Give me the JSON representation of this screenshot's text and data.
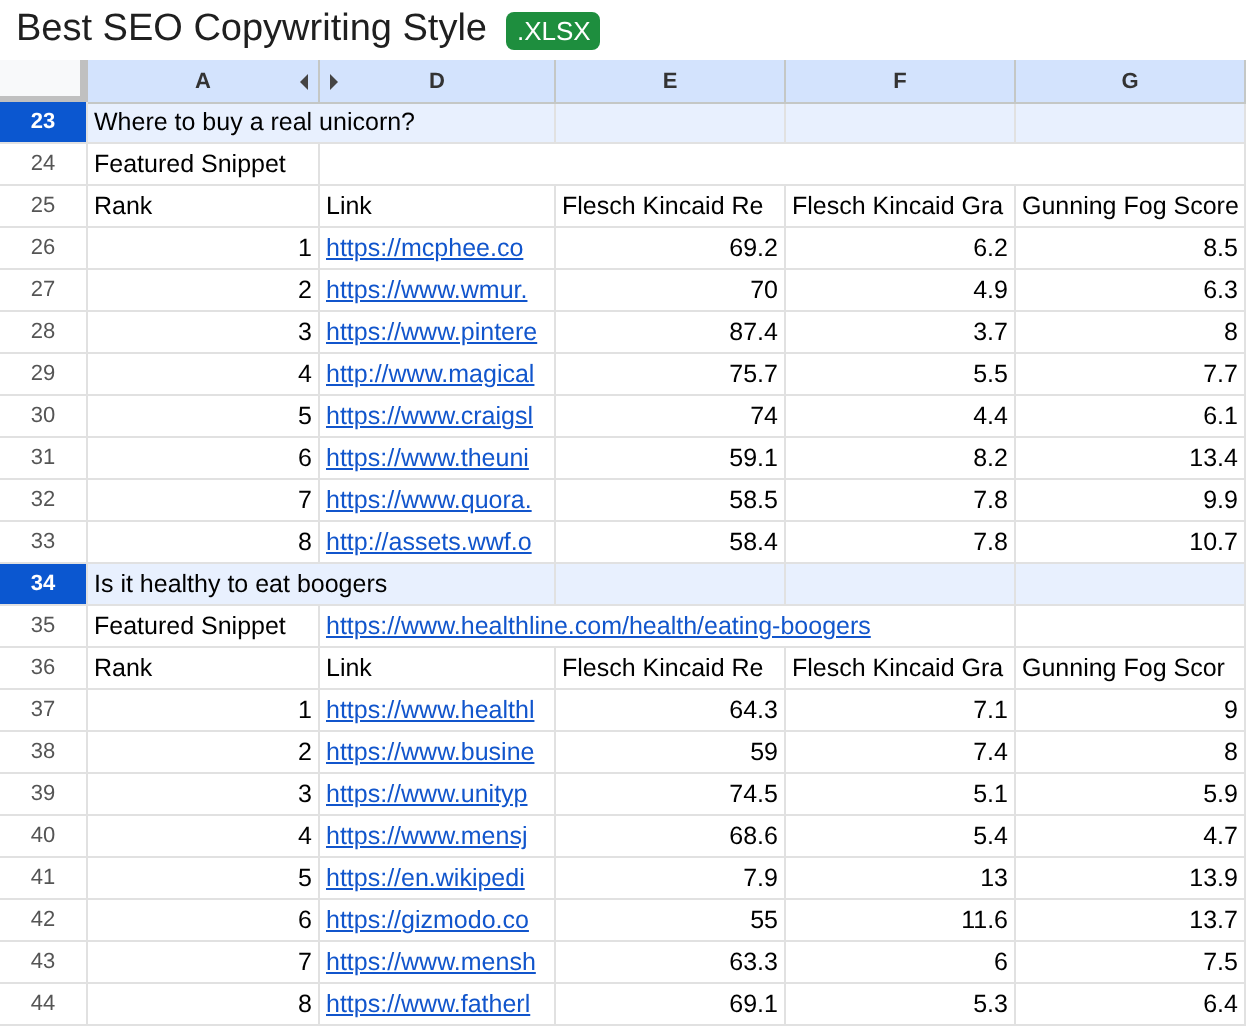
{
  "document": {
    "title": "Best SEO Copywriting Style",
    "badge": ".XLSX"
  },
  "columns": [
    {
      "label": "A",
      "hidden_after": true
    },
    {
      "label": "D",
      "hidden_after": false
    },
    {
      "label": "E",
      "hidden_after": false
    },
    {
      "label": "F",
      "hidden_after": false
    },
    {
      "label": "G",
      "hidden_after": false
    }
  ],
  "rows": [
    {
      "number": "23",
      "kind": "section",
      "selected": true,
      "text": "Where to buy a real unicorn?"
    },
    {
      "number": "24",
      "kind": "snippet",
      "selected": false,
      "label": "Featured Snippet"
    },
    {
      "number": "25",
      "kind": "header",
      "selected": false,
      "cells": [
        "Rank",
        "Link",
        "Flesch Kincaid Re",
        "Flesch Kincaid Gra",
        "Gunning Fog Score"
      ]
    },
    {
      "number": "26",
      "kind": "data",
      "selected": false,
      "rank": "1",
      "link": "https://mcphee.co",
      "values": [
        "69.2",
        "6.2",
        "8.5"
      ]
    },
    {
      "number": "27",
      "kind": "data",
      "selected": false,
      "rank": "2",
      "link": "https://www.wmur.",
      "values": [
        "70",
        "4.9",
        "6.3"
      ]
    },
    {
      "number": "28",
      "kind": "data",
      "selected": false,
      "rank": "3",
      "link": "https://www.pintere",
      "values": [
        "87.4",
        "3.7",
        "8"
      ]
    },
    {
      "number": "29",
      "kind": "data",
      "selected": false,
      "rank": "4",
      "link": "http://www.magical",
      "values": [
        "75.7",
        "5.5",
        "7.7"
      ]
    },
    {
      "number": "30",
      "kind": "data",
      "selected": false,
      "rank": "5",
      "link": "https://www.craigsl",
      "values": [
        "74",
        "4.4",
        "6.1"
      ]
    },
    {
      "number": "31",
      "kind": "data",
      "selected": false,
      "rank": "6",
      "link": "https://www.theuni",
      "values": [
        "59.1",
        "8.2",
        "13.4"
      ]
    },
    {
      "number": "32",
      "kind": "data",
      "selected": false,
      "rank": "7",
      "link": "https://www.quora.",
      "values": [
        "58.5",
        "7.8",
        "9.9"
      ]
    },
    {
      "number": "33",
      "kind": "data",
      "selected": false,
      "rank": "8",
      "link": "http://assets.wwf.o",
      "values": [
        "58.4",
        "7.8",
        "10.7"
      ]
    },
    {
      "number": "34",
      "kind": "section",
      "selected": true,
      "text": "Is it healthy to eat boogers"
    },
    {
      "number": "35",
      "kind": "snippet",
      "selected": false,
      "label": "Featured Snippet",
      "link": "https://www.healthline.com/health/eating-boogers"
    },
    {
      "number": "36",
      "kind": "header",
      "selected": false,
      "cells": [
        "Rank",
        "Link",
        "Flesch Kincaid Re",
        "Flesch Kincaid Gra",
        "Gunning Fog Scor"
      ]
    },
    {
      "number": "37",
      "kind": "data",
      "selected": false,
      "rank": "1",
      "link": "https://www.healthl",
      "values": [
        "64.3",
        "7.1",
        "9"
      ]
    },
    {
      "number": "38",
      "kind": "data",
      "selected": false,
      "rank": "2",
      "link": "https://www.busine",
      "values": [
        "59",
        "7.4",
        "8"
      ]
    },
    {
      "number": "39",
      "kind": "data",
      "selected": false,
      "rank": "3",
      "link": "https://www.unityp",
      "values": [
        "74.5",
        "5.1",
        "5.9"
      ]
    },
    {
      "number": "40",
      "kind": "data",
      "selected": false,
      "rank": "4",
      "link": "https://www.mensj",
      "values": [
        "68.6",
        "5.4",
        "4.7"
      ]
    },
    {
      "number": "41",
      "kind": "data",
      "selected": false,
      "rank": "5",
      "link": "https://en.wikipedi",
      "values": [
        "7.9",
        "13",
        "13.9"
      ]
    },
    {
      "number": "42",
      "kind": "data",
      "selected": false,
      "rank": "6",
      "link": "https://gizmodo.co",
      "values": [
        "55",
        "11.6",
        "13.7"
      ]
    },
    {
      "number": "43",
      "kind": "data",
      "selected": false,
      "rank": "7",
      "link": "https://www.mensh",
      "values": [
        "63.3",
        "6",
        "7.5"
      ]
    },
    {
      "number": "44",
      "kind": "data",
      "selected": false,
      "rank": "8",
      "link": "https://www.fatherl",
      "values": [
        "69.1",
        "5.3",
        "6.4"
      ]
    }
  ]
}
